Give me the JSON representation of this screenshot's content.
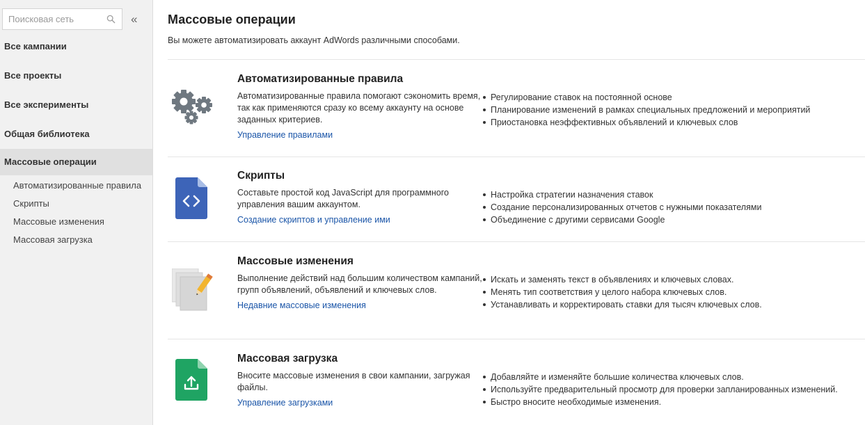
{
  "sidebar": {
    "search_placeholder": "Поисковая сеть",
    "collapse_label": "«",
    "items": [
      {
        "label": "Все кампании"
      },
      {
        "label": "Все проекты"
      },
      {
        "label": "Все эксперименты"
      },
      {
        "label": "Общая библиотека"
      },
      {
        "label": "Массовые операции"
      }
    ],
    "subitems": [
      {
        "label": "Автоматизированные правила"
      },
      {
        "label": "Скрипты"
      },
      {
        "label": "Массовые изменения"
      },
      {
        "label": "Массовая загрузка"
      }
    ]
  },
  "main": {
    "title": "Массовые операции",
    "description": "Вы можете автоматизировать аккаунт AdWords различными способами.",
    "sections": [
      {
        "title": "Автоматизированные правила",
        "text": "Автоматизированные правила помогают сэкономить время, так как применяются сразу ко всему аккаунту на основе заданных критериев.",
        "link": "Управление правилами",
        "icon": "gears-icon",
        "bullets": [
          "Регулирование ставок на постоянной основе",
          "Планирование изменений в рамках специальных предложений и мероприятий",
          "Приостановка неэффективных объявлений и ключевых слов"
        ]
      },
      {
        "title": "Скрипты",
        "text": "Составьте простой код JavaScript для программного управления вашим аккаунтом.",
        "link": "Создание скриптов и управление ими",
        "icon": "code-file-icon",
        "bullets": [
          "Настройка стратегии назначения ставок",
          "Создание персонализированных отчетов с нужными показателями",
          "Объединение с другими сервисами Google"
        ]
      },
      {
        "title": "Массовые изменения",
        "text": "Выполнение действий над большим количеством кампаний, групп объявлений, объявлений и ключевых слов.",
        "link": "Недавние массовые изменения",
        "icon": "pages-pencil-icon",
        "bullets": [
          "Искать и заменять текст в объявлениях и ключевых словах.",
          "Менять тип соответствия у целого набора ключевых слов.",
          "Устанавливать и корректировать ставки для тысяч ключевых слов."
        ]
      },
      {
        "title": "Массовая загрузка",
        "text": "Вносите массовые изменения в свои кампании, загружая файлы.",
        "link": "Управление загрузками",
        "icon": "upload-file-icon",
        "bullets": [
          "Добавляйте и изменяйте большие количества ключевых слов.",
          "Используйте предварительный просмотр для проверки запланированных изменений.",
          "Быстро вносите необходимые изменения."
        ]
      }
    ]
  },
  "colors": {
    "link": "#1a55a8",
    "sidebar_bg": "#f1f1f1",
    "active_bg": "#e0e0e0",
    "scripts_blue": "#3d64b8",
    "upload_green": "#1fa463"
  }
}
